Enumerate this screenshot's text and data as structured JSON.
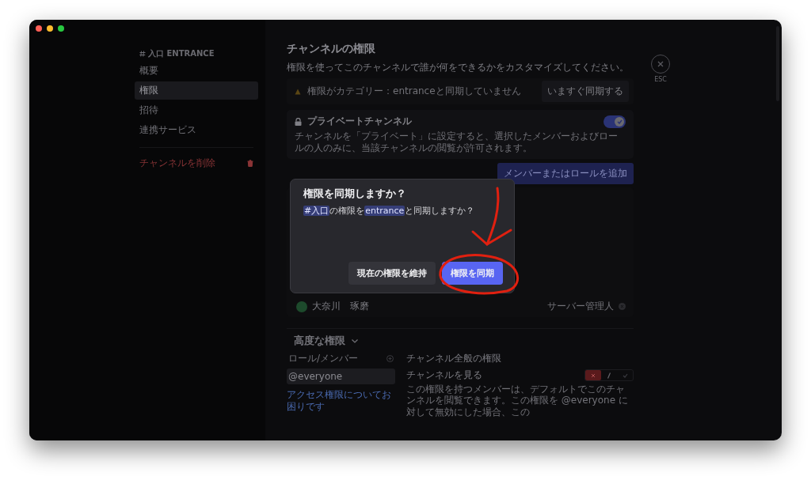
{
  "sidebar": {
    "header": "入口 ENTRANCE",
    "items": [
      {
        "label": "概要",
        "selected": false
      },
      {
        "label": "権限",
        "selected": true
      },
      {
        "label": "招待",
        "selected": false
      },
      {
        "label": "連携サービス",
        "selected": false
      }
    ],
    "delete_label": "チャンネルを削除"
  },
  "main": {
    "title": "チャンネルの権限",
    "description": "権限を使ってこのチャンネルで誰が何をできるかをカスタマイズしてください。",
    "sync_notice": {
      "text": "権限がカテゴリー：entranceと同期していません",
      "button": "いますぐ同期する"
    },
    "private_channel": {
      "title": "プライベートチャンネル",
      "on": true,
      "description": "チャンネルを「プライベート」に設定すると、選択したメンバーおよびロールの人のみに、当該チャンネルの閲覧が許可されます。"
    },
    "add_button": "メンバーまたはロールを追加",
    "members": [
      {
        "name": "大奈川　琢磨",
        "role": "サーバー管理人"
      }
    ],
    "advanced": {
      "title": "高度な権限",
      "roles_header": "ロール/メンバー",
      "roles": [
        {
          "label": "@everyone",
          "selected": true
        }
      ],
      "help_link": "アクセス権限についてお困りです",
      "section_title": "チャンネル全般の権限",
      "permissions": [
        {
          "name": "チャンネルを見る",
          "denied": true,
          "allowed": false,
          "description": "この権限を持つメンバーは、デフォルトでこのチャンネルを閲覧できます。この権限を @everyone に対して無効にした場合、この"
        }
      ]
    }
  },
  "close_label": "ESC",
  "dialog": {
    "title": "権限を同期しますか？",
    "message": [
      {
        "text": "#入口",
        "kind": "mention"
      },
      {
        "text": "の権限を",
        "kind": "plain"
      },
      {
        "text": "entrance",
        "kind": "mention"
      },
      {
        "text": "と同期しますか？",
        "kind": "plain"
      }
    ],
    "buttons": [
      {
        "label": "現在の権限を維持",
        "kind": "secondary"
      },
      {
        "label": "権限を同期",
        "kind": "primary"
      }
    ]
  }
}
